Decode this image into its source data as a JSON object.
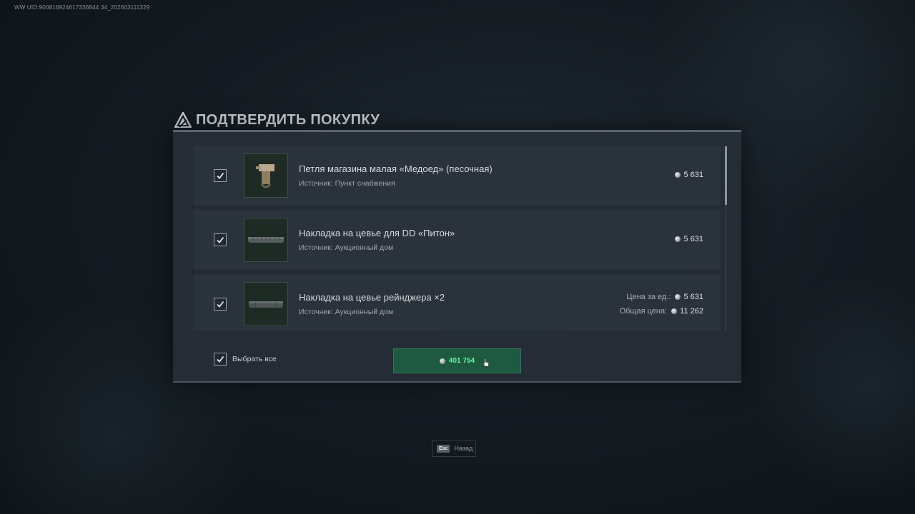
{
  "uid_text": "WW UID:900816924617336844 34_202603111329",
  "dialog": {
    "title": "ПОДТВЕРДИТЬ ПОКУПКУ"
  },
  "items": [
    {
      "name": "Петля магазина малая «Медоед» (песочная)",
      "source": "Источник: Пункт снабжения",
      "price": "5 631",
      "checked": true,
      "icon": "magazine-loop-icon"
    },
    {
      "name": "Накладка на цевье для DD «Питон»",
      "source": "Источник: Аукционный дом",
      "price": "5 631",
      "checked": true,
      "icon": "handguard-rail-icon"
    },
    {
      "name": "Накладка на цевье рейнджера ×2",
      "source": "Источник: Аукционный дом",
      "unit_price_label": "Цена за ед.:",
      "unit_price": "5 631",
      "total_price_label": "Общая цена:",
      "total_price": "11 262",
      "checked": true,
      "icon": "handguard-rail-icon"
    }
  ],
  "footer": {
    "select_all_label": "Выбрать все",
    "select_all_checked": true,
    "buy_total": "401 754"
  },
  "esc_hint": {
    "key": "Esc",
    "label": "Назад"
  },
  "colors": {
    "accent_green": "#6ff2a6",
    "buy_button_bg": "#1d5a41"
  }
}
